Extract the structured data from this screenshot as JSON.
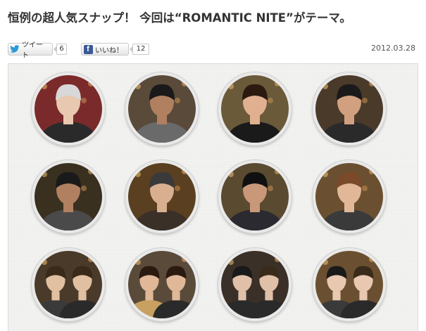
{
  "article": {
    "title": "恒例の超人気スナップ！ 今回は“ROMANTIC NITE”がテーマ。",
    "date": "2012.03.28"
  },
  "social": {
    "tweet_label": "ツイート",
    "tweet_count": "6",
    "like_label": "いいね！",
    "like_count": "12",
    "tweet_icon": "twitter-bird-icon",
    "like_icon": "facebook-f-icon"
  },
  "gallery": {
    "rows": 3,
    "columns": 4,
    "photos": [
      {
        "bg": "#7a2a2a",
        "skin": "#e8c8b0",
        "hair": "#d8d8d8",
        "cloth": "#2a2a2a",
        "people": 1
      },
      {
        "bg": "#5a4a3a",
        "skin": "#b08060",
        "hair": "#1a1a1a",
        "cloth": "#6a6a6a",
        "people": 1
      },
      {
        "bg": "#6a5a3a",
        "skin": "#e0b090",
        "hair": "#2a1a10",
        "cloth": "#1a1a1a",
        "people": 1
      },
      {
        "bg": "#4a3a2a",
        "skin": "#d0a080",
        "hair": "#1a1a1a",
        "cloth": "#2a2a2a",
        "people": 1
      },
      {
        "bg": "#3a3020",
        "skin": "#b08060",
        "hair": "#1a1a1a",
        "cloth": "#4a4a4a",
        "people": 1
      },
      {
        "bg": "#5a4020",
        "skin": "#d8b090",
        "hair": "#3a3a3a",
        "cloth": "#3a3028",
        "people": 1
      },
      {
        "bg": "#5a4a30",
        "skin": "#c89878",
        "hair": "#101010",
        "cloth": "#2a2a30",
        "people": 1
      },
      {
        "bg": "#6a5030",
        "skin": "#e0b898",
        "hair": "#7a4a2a",
        "cloth": "#3a3a3a",
        "people": 1
      },
      {
        "bg": "#4a3a2a",
        "skin": "#e0c0a0",
        "hair": "#3a2a1a",
        "cloth": "#3a3a3a",
        "people": 2
      },
      {
        "bg": "#5a4a3a",
        "skin": "#e0b898",
        "hair": "#2a1a10",
        "cloth": "#c8a060",
        "people": 2
      },
      {
        "bg": "#3a3028",
        "skin": "#e0c0a8",
        "hair": "#1a1a1a",
        "cloth": "#2a2a2a",
        "people": 2
      },
      {
        "bg": "#6a5030",
        "skin": "#e8c8b0",
        "hair": "#1a1a1a",
        "cloth": "#3a3a3a",
        "people": 2
      }
    ]
  }
}
